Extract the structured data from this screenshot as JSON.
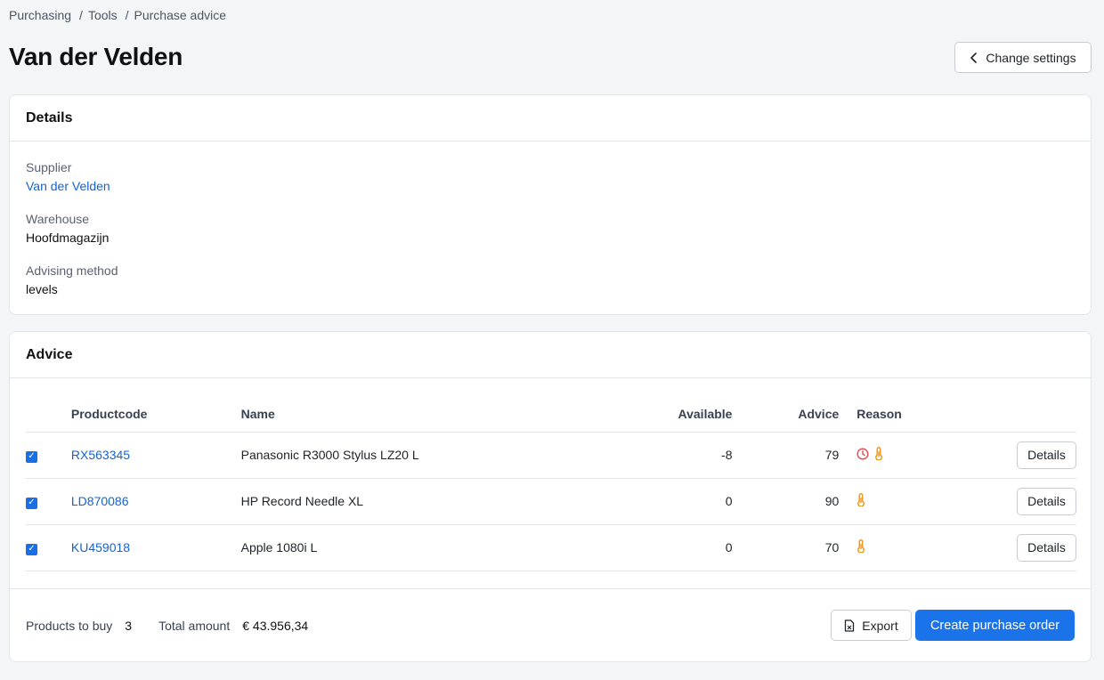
{
  "breadcrumb": [
    "Purchasing",
    "Tools",
    "Purchase advice"
  ],
  "page_title": "Van der Velden",
  "change_settings_label": "Change settings",
  "details": {
    "heading": "Details",
    "supplier_label": "Supplier",
    "supplier_value": "Van der Velden",
    "warehouse_label": "Warehouse",
    "warehouse_value": "Hoofdmagazijn",
    "method_label": "Advising method",
    "method_value": "levels"
  },
  "advice": {
    "heading": "Advice",
    "columns": {
      "productcode": "Productcode",
      "name": "Name",
      "available": "Available",
      "advice": "Advice",
      "reason": "Reason"
    },
    "rows": [
      {
        "checked": true,
        "code": "RX563345",
        "name": "Panasonic R3000 Stylus LZ20 L",
        "available": "-8",
        "advice": "79",
        "reasons": [
          "clock-icon",
          "thermometer-icon"
        ],
        "button": "Details"
      },
      {
        "checked": true,
        "code": "LD870086",
        "name": "HP Record Needle XL",
        "available": "0",
        "advice": "90",
        "reasons": [
          "thermometer-icon"
        ],
        "button": "Details"
      },
      {
        "checked": true,
        "code": "KU459018",
        "name": "Apple 1080i L",
        "available": "0",
        "advice": "70",
        "reasons": [
          "thermometer-icon"
        ],
        "button": "Details"
      }
    ],
    "footer": {
      "products_label": "Products to buy",
      "products_value": "3",
      "total_label": "Total amount",
      "total_value": "€ 43.956,34",
      "export_label": "Export",
      "create_label": "Create purchase order"
    }
  },
  "colors": {
    "link": "#1463d2",
    "primary_button": "#1a73e8",
    "clock_icon": "#e5484d",
    "thermometer_icon": "#f08c00"
  }
}
